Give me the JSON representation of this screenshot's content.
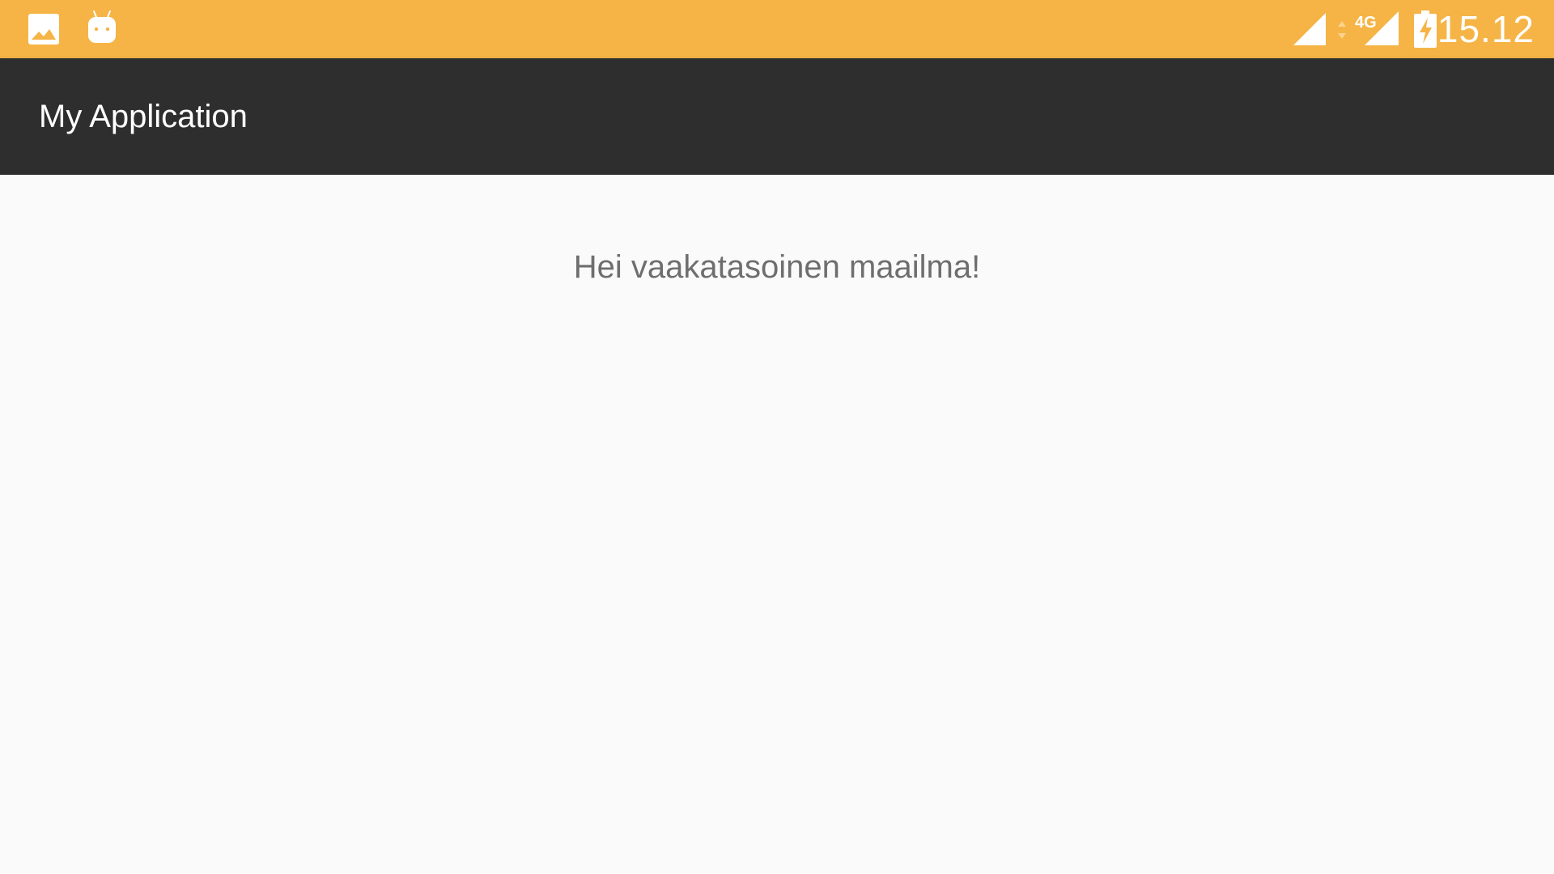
{
  "status_bar": {
    "background_color": "#f5b445",
    "left_icons": [
      "image-icon",
      "android-icon"
    ],
    "right_icons": [
      "signal-icon",
      "data-arrows-icon",
      "network-4g-icon",
      "battery-charging-icon"
    ],
    "network_type": "4G",
    "time": "15.12"
  },
  "app_bar": {
    "background_color": "#2e2e2e",
    "title": "My Application"
  },
  "main": {
    "background_color": "#fafafa",
    "message": "Hei vaakatasoinen maailma!"
  }
}
